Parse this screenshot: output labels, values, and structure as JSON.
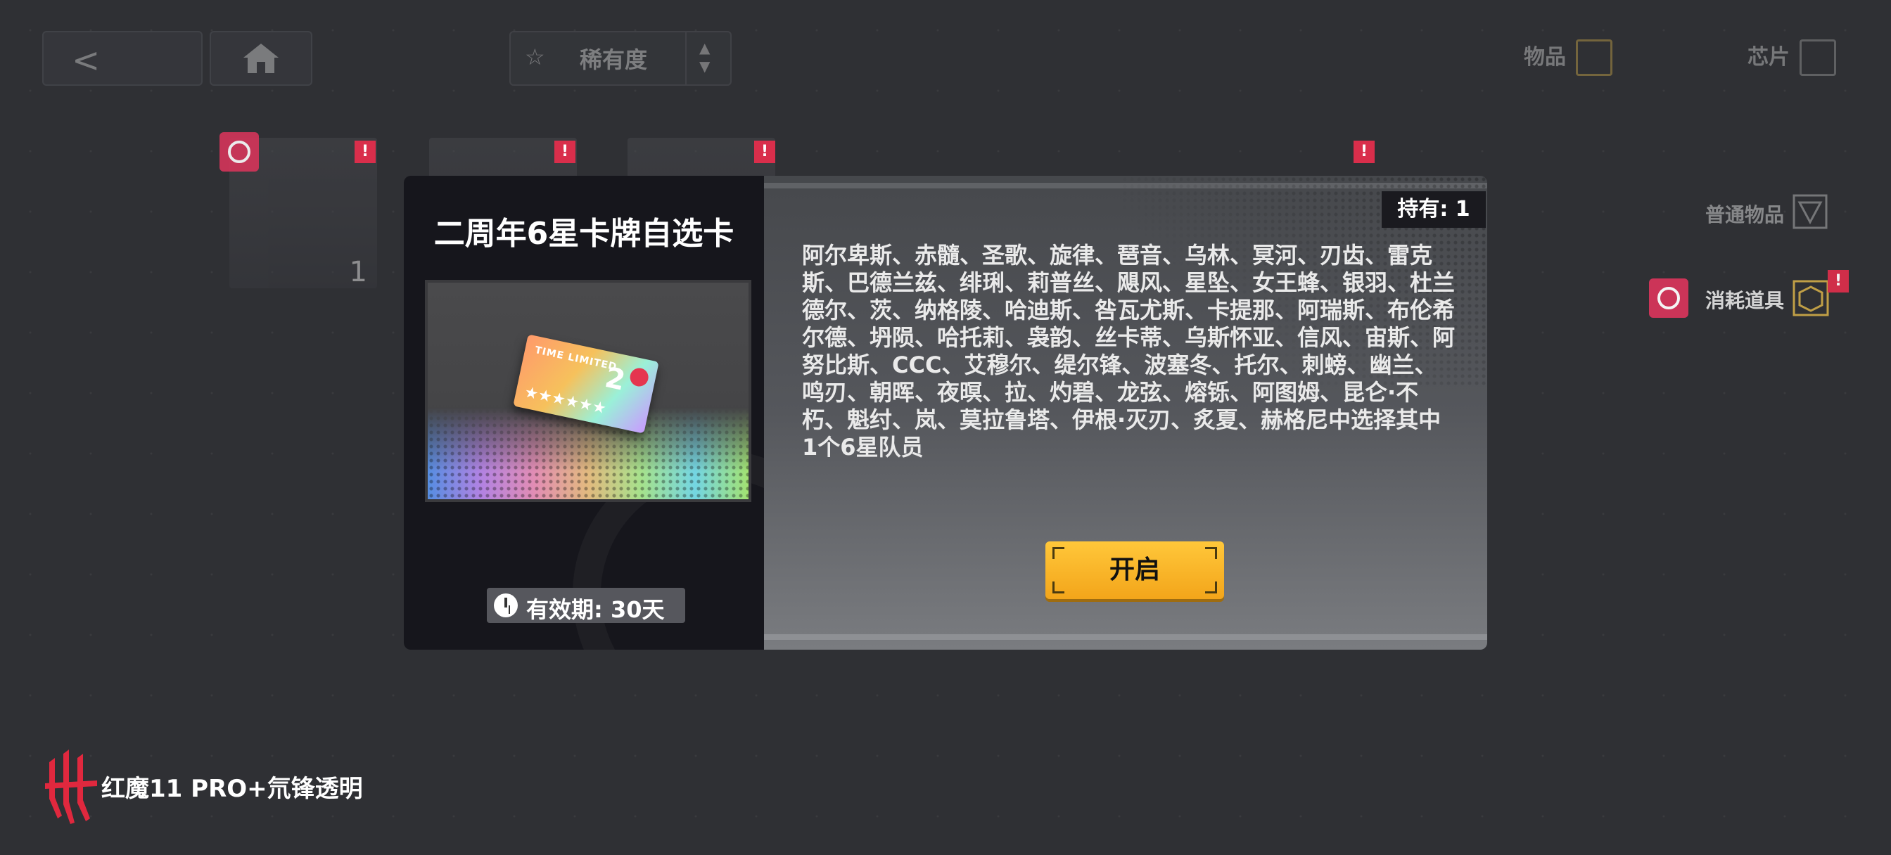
{
  "topbar": {
    "sort_label": "稀有度",
    "tab_items_label": "物品",
    "tab_chips_label": "芯片"
  },
  "side": {
    "ordinary_label": "普通物品",
    "consumables_label": "消耗道具"
  },
  "grid": {
    "first_item_count": "1",
    "alert_mark": "!"
  },
  "modal": {
    "title": "二周年6星卡牌自选卡",
    "owned": "持有: 1",
    "description": "阿尔卑斯、赤髓、圣歌、旋律、琶音、乌林、冥河、刃齿、雷克斯、巴德兰兹、绯琍、莉普丝、飓风、星坠、女王蜂、银羽、杜兰德尔、茨、纳格陵、哈迪斯、咎瓦尤斯、卡提那、阿瑞斯、布伦希尔德、坍陨、哈托莉、袅韵、丝卡蒂、乌斯怀亚、信风、宙斯、阿努比斯、CCC、艾穆尔、缇尔锋、波塞冬、托尔、刺螃、幽兰、鸣刃、朝晖、夜暝、拉、灼碧、龙弦、熔铄、阿图姆、昆仑·不朽、魁纣、岚、莫拉鲁塔、伊根·灭刃、炙夏、赫格尼中选择其中1个6星队员",
    "validity": "有效期: 30天",
    "open_button": "开启",
    "card_art": {
      "time_limited": "TIME LIMITED",
      "number": "2",
      "stars": "★★★★★★"
    }
  },
  "watermark": {
    "text": "红魔11 PRO+氘锋透明"
  },
  "colors": {
    "accent_gold": "#f3a51a",
    "alert_red": "#d92e4b",
    "modal_left_bg": "#16161c"
  }
}
